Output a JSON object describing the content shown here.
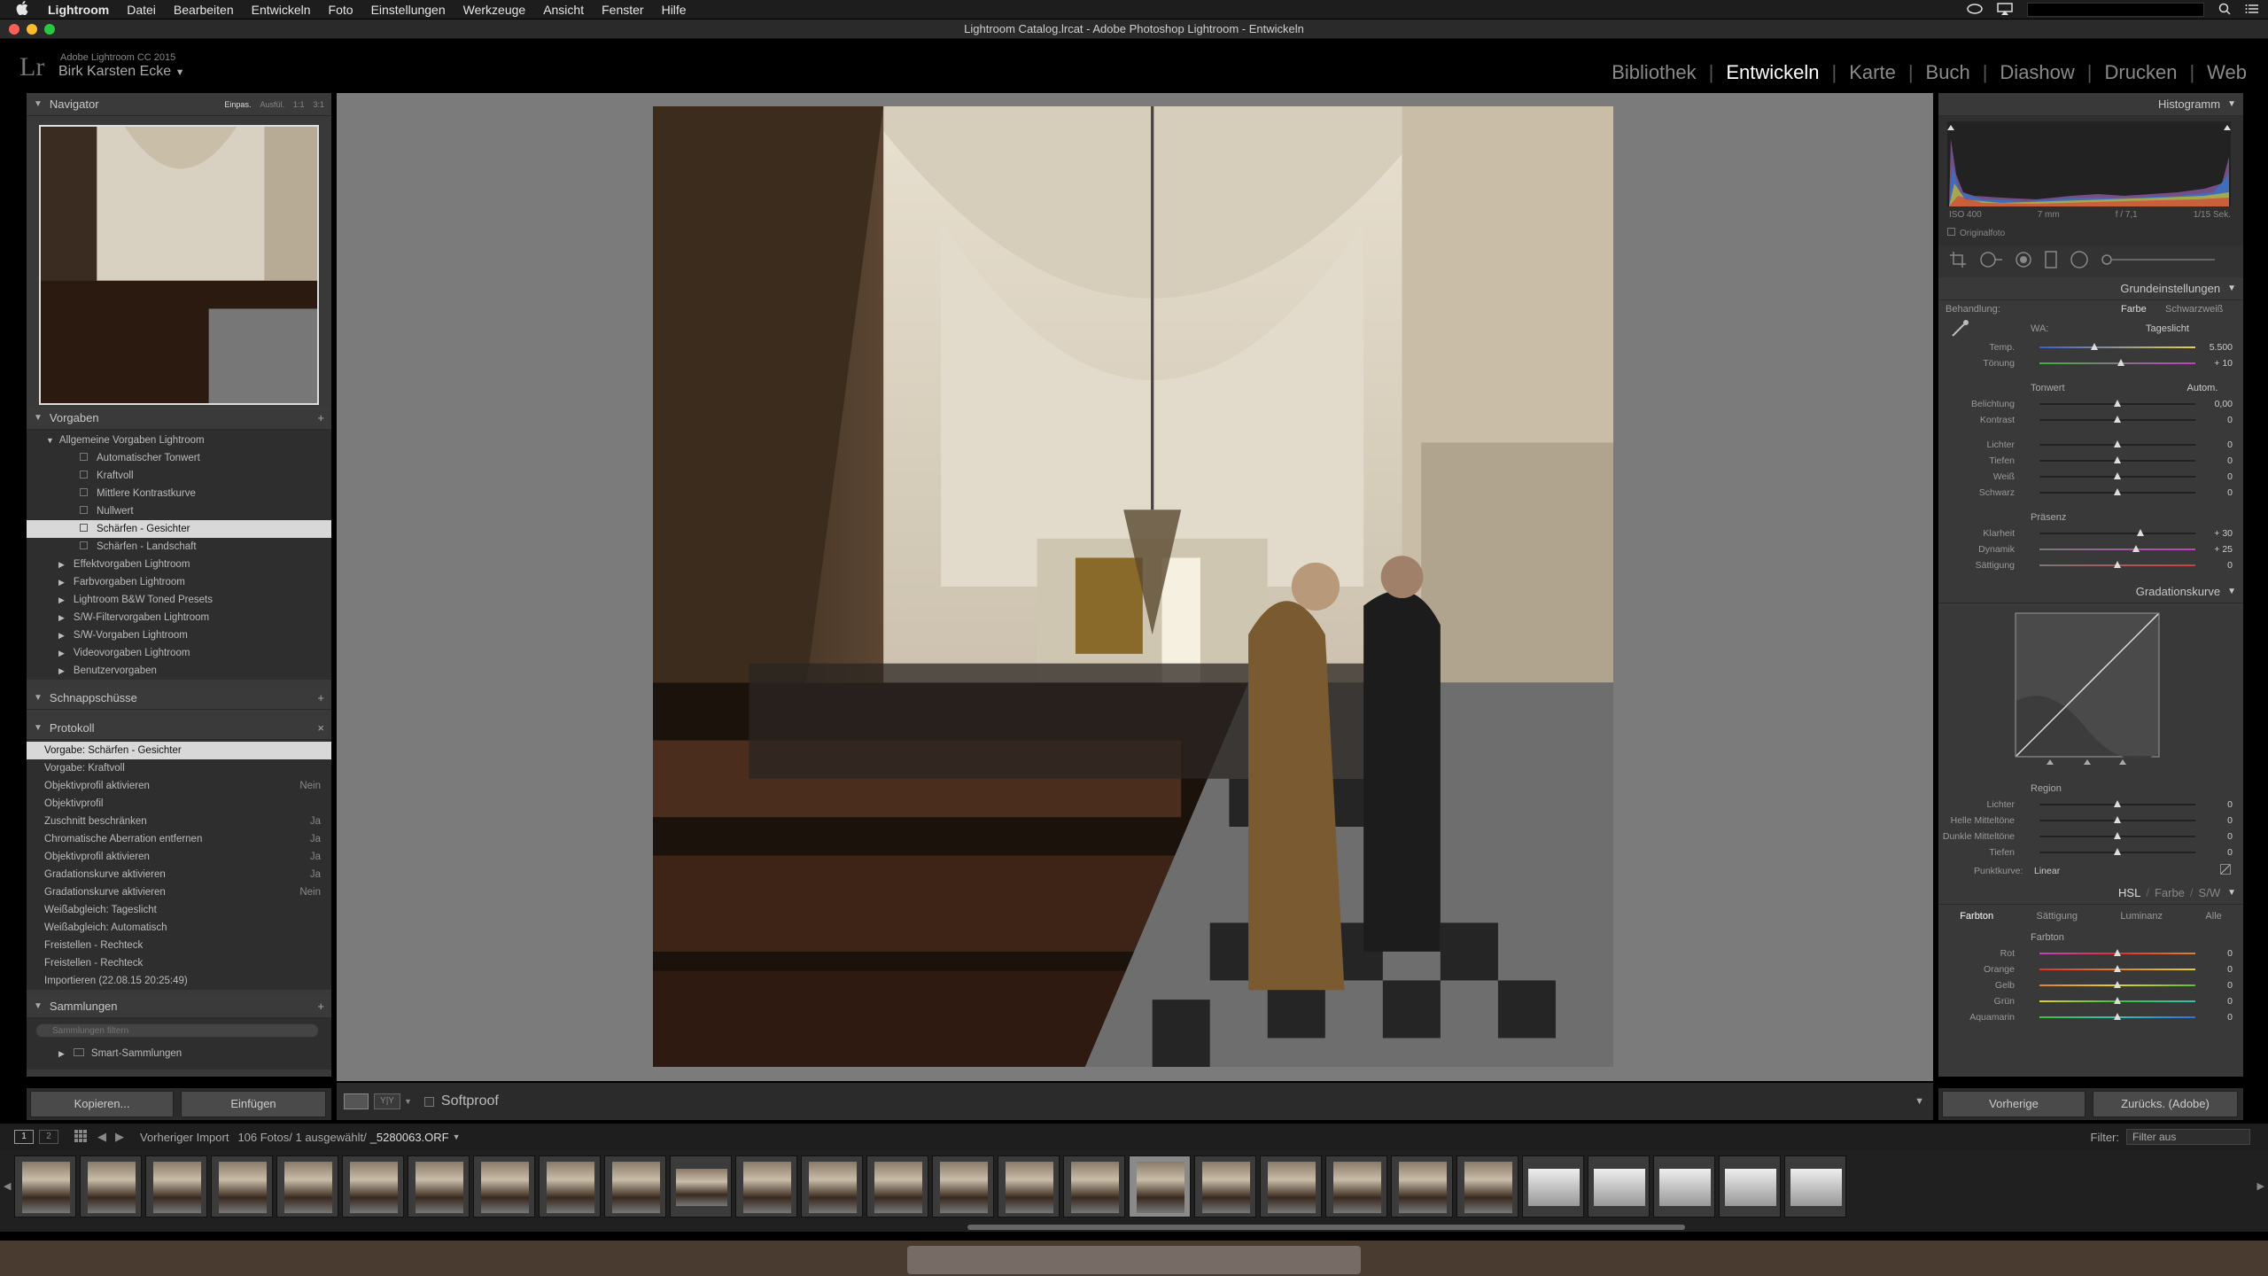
{
  "menubar": {
    "apple": "",
    "app": "Lightroom",
    "items": [
      "Datei",
      "Bearbeiten",
      "Entwickeln",
      "Foto",
      "Einstellungen",
      "Werkzeuge",
      "Ansicht",
      "Fenster",
      "Hilfe"
    ]
  },
  "window": {
    "title": "Lightroom Catalog.lrcat - Adobe Photoshop Lightroom - Entwickeln"
  },
  "header": {
    "logo": "Lr",
    "version": "Adobe Lightroom CC 2015",
    "user": "Birk Karsten Ecke",
    "user_caret": "▼"
  },
  "modules": [
    "Bibliothek",
    "Entwickeln",
    "Karte",
    "Buch",
    "Diashow",
    "Drucken",
    "Web"
  ],
  "active_module": "Entwickeln",
  "navigator": {
    "title": "Navigator",
    "zoom_options": [
      "Einpas.",
      "Ausfül.",
      "1:1",
      "3:1"
    ]
  },
  "presets": {
    "title": "Vorgaben",
    "plus": "+",
    "folder_open": "Allgemeine Vorgaben Lightroom",
    "items": [
      "Automatischer Tonwert",
      "Kraftvoll",
      "Mittlere Kontrastkurve",
      "Nullwert",
      "Schärfen - Gesichter",
      "Schärfen - Landschaft"
    ],
    "selected": "Schärfen - Gesichter",
    "folders": [
      "Effektvorgaben Lightroom",
      "Farbvorgaben Lightroom",
      "Lightroom B&W Toned Presets",
      "S/W-Filtervorgaben Lightroom",
      "S/W-Vorgaben Lightroom",
      "Videovorgaben Lightroom",
      "Benutzervorgaben"
    ]
  },
  "snapshots": {
    "title": "Schnappschüsse",
    "plus": "+"
  },
  "history": {
    "title": "Protokoll",
    "close": "×",
    "items": [
      {
        "label": "Vorgabe: Schärfen - Gesichter",
        "value": ""
      },
      {
        "label": "Vorgabe: Kraftvoll",
        "value": ""
      },
      {
        "label": "Objektivprofil aktivieren",
        "value": "Nein"
      },
      {
        "label": "Objektivprofil",
        "value": ""
      },
      {
        "label": "Zuschnitt beschränken",
        "value": "Ja"
      },
      {
        "label": "Chromatische Aberration entfernen",
        "value": "Ja"
      },
      {
        "label": "Objektivprofil aktivieren",
        "value": "Ja"
      },
      {
        "label": "Gradationskurve aktivieren",
        "value": "Ja"
      },
      {
        "label": "Gradationskurve aktivieren",
        "value": "Nein"
      },
      {
        "label": "Weißabgleich: Tageslicht",
        "value": ""
      },
      {
        "label": "Weißabgleich: Automatisch",
        "value": ""
      },
      {
        "label": "Freistellen - Rechteck",
        "value": ""
      },
      {
        "label": "Freistellen - Rechteck",
        "value": ""
      },
      {
        "label": "Importieren (22.08.15 20:25:49)",
        "value": ""
      }
    ]
  },
  "collections": {
    "title": "Sammlungen",
    "plus": "+",
    "search_placeholder": "Sammlungen filtern",
    "item": "Smart-Sammlungen"
  },
  "left_buttons": {
    "copy": "Kopieren...",
    "paste": "Einfügen"
  },
  "toolbar": {
    "softproof": "Softproof"
  },
  "histogram": {
    "title": "Histogramm",
    "iso": "ISO 400",
    "focal": "7 mm",
    "aperture": "f / 7,1",
    "shutter": "1/15 Sek.",
    "original": "Originalfoto"
  },
  "basic": {
    "title": "Grundeinstellungen",
    "treatment_label": "Behandlung:",
    "treatment_color": "Farbe",
    "treatment_bw": "Schwarzweiß",
    "wb_label": "WA:",
    "wb_value": "Tageslicht",
    "tone_label": "Tonwert",
    "auto": "Autom.",
    "presence_label": "Präsenz",
    "sliders": [
      {
        "label": "Temp.",
        "value": "5.500",
        "pos": 0.35
      },
      {
        "label": "Tönung",
        "value": "+ 10",
        "pos": 0.52
      },
      {
        "label": "Belichtung",
        "value": "0,00",
        "pos": 0.5
      },
      {
        "label": "Kontrast",
        "value": "0",
        "pos": 0.5
      },
      {
        "label": "Lichter",
        "value": "0",
        "pos": 0.5
      },
      {
        "label": "Tiefen",
        "value": "0",
        "pos": 0.5
      },
      {
        "label": "Weiß",
        "value": "0",
        "pos": 0.5
      },
      {
        "label": "Schwarz",
        "value": "0",
        "pos": 0.5
      },
      {
        "label": "Klarheit",
        "value": "+ 30",
        "pos": 0.65
      },
      {
        "label": "Dynamik",
        "value": "+ 25",
        "pos": 0.62
      },
      {
        "label": "Sättigung",
        "value": "0",
        "pos": 0.5
      }
    ]
  },
  "tonecurve": {
    "title": "Gradationskurve",
    "region": "Region",
    "point_curve_label": "Punktkurve:",
    "point_curve_value": "Linear",
    "sliders": [
      {
        "label": "Lichter",
        "value": "0",
        "pos": 0.5
      },
      {
        "label": "Helle Mitteltöne",
        "value": "0",
        "pos": 0.5
      },
      {
        "label": "Dunkle Mitteltöne",
        "value": "0",
        "pos": 0.5
      },
      {
        "label": "Tiefen",
        "value": "0",
        "pos": 0.5
      }
    ]
  },
  "hsl": {
    "title_hsl": "HSL",
    "title_color": "Farbe",
    "title_bw": "S/W",
    "tabs": [
      "Farbton",
      "Sättigung",
      "Luminanz",
      "Alle"
    ],
    "section": "Farbton",
    "sliders": [
      {
        "label": "Rot",
        "value": "0"
      },
      {
        "label": "Orange",
        "value": "0"
      },
      {
        "label": "Gelb",
        "value": "0"
      },
      {
        "label": "Grün",
        "value": "0"
      },
      {
        "label": "Aquamarin",
        "value": "0"
      }
    ]
  },
  "right_buttons": {
    "previous": "Vorherige",
    "reset": "Zurücks. (Adobe)"
  },
  "filmstrip": {
    "view1": "1",
    "view2": "2",
    "source": "Vorheriger Import",
    "count": "106 Fotos/ 1 ausgewählt/",
    "filename": "_5280063.ORF",
    "filter_label": "Filter:",
    "filter_value": "Filter aus",
    "selected_index": 17,
    "thumbs_portrait": 23,
    "thumbs_land": 5
  },
  "colors": {
    "accent": "#ffffff",
    "panel": "#393939",
    "center_bg": "#7b7b7b"
  }
}
